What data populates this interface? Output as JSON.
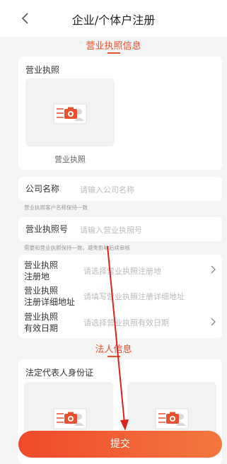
{
  "header": {
    "title": "企业/个体户注册",
    "back_icon": "chevron-left-icon"
  },
  "sections": {
    "license_title": "营业执照信息",
    "legal_title": "法人信息"
  },
  "license_card": {
    "title": "营业执照",
    "upload_label": "营业执照",
    "icon": "camera-icon"
  },
  "company_name": {
    "label": "公司名称",
    "placeholder": "请输入公司名称",
    "hint": "营业执照客户名称保持一致"
  },
  "license_number": {
    "label": "营业执照号",
    "placeholder": "请输入营业执照号",
    "hint": "需要和营业执照保持一致，避免影响后续审核"
  },
  "register_place": {
    "label_line1": "营业执照",
    "label_line2": "注册地",
    "placeholder": "请选择营业执照注册地"
  },
  "register_address": {
    "label_line1": "营业执照",
    "label_line2": "注册详细地址",
    "placeholder": "请填写营业执照注册详细地址"
  },
  "valid_date": {
    "label_line1": "营业执照",
    "label_line2": "有效日期",
    "placeholder": "请选择营业执照有效日期"
  },
  "legal_card": {
    "title": "法定代表人身份证",
    "icon": "camera-icon"
  },
  "submit_label": "提交",
  "colors": {
    "accent": "#e8502f",
    "annotation_arrow": "#e02020"
  }
}
